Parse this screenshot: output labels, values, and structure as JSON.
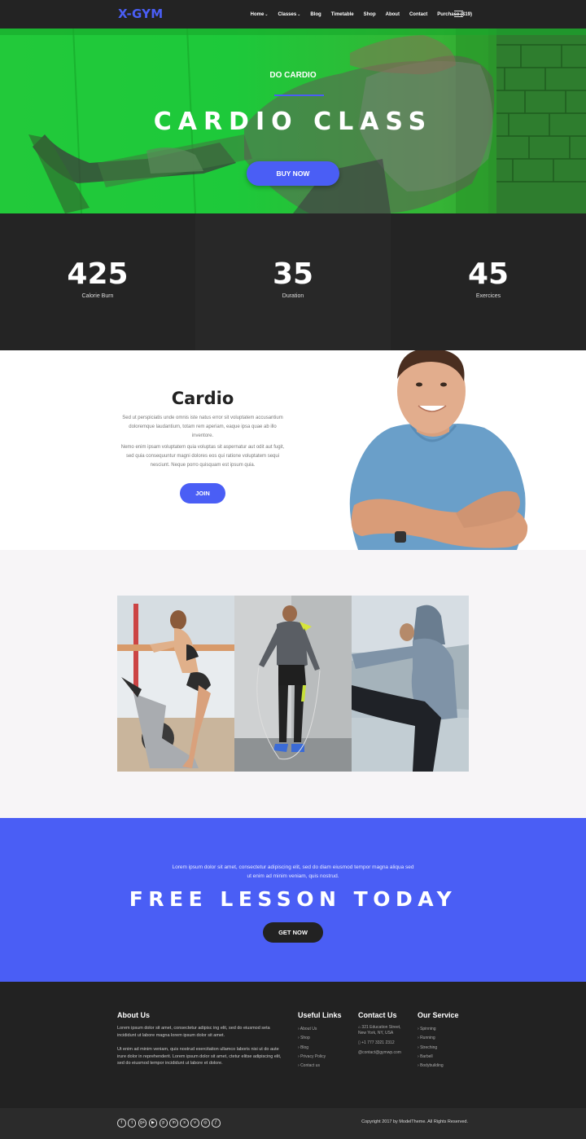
{
  "header": {
    "logo": "X-GYM",
    "nav": [
      {
        "label": "Home",
        "dropdown": true
      },
      {
        "label": "Classes",
        "dropdown": true
      },
      {
        "label": "Blog",
        "dropdown": false
      },
      {
        "label": "Timetable",
        "dropdown": false
      },
      {
        "label": "Shop",
        "dropdown": false
      },
      {
        "label": "About",
        "dropdown": false
      },
      {
        "label": "Contact",
        "dropdown": false
      },
      {
        "label": "Purchase ($19)",
        "dropdown": false
      }
    ],
    "menu_icon": "hamburger-icon"
  },
  "hero": {
    "subtitle": "DO CARDIO",
    "title": "CARDIO CLASS",
    "button": "BUY NOW"
  },
  "stats": [
    {
      "value": "425",
      "label": "Calorie Burn"
    },
    {
      "value": "35",
      "label": "Duration"
    },
    {
      "value": "45",
      "label": "Exercices"
    }
  ],
  "cardio": {
    "title": "Cardio",
    "p1": "Sed ut perspiciatis unde omnis iste natus error sit voluptatem accusantium doloremque laudantium, totam rem aperiam, eaque ipsa quae ab illo inventore.",
    "p2": "Nemo enim ipsam voluptatem quia voluptas sit aspernatur aut odit aut fugit, sed quia consequuntur magni dolores eos qui ratione voluptatem sequi nesciunt. Neque porro quisquam est ipsum quia.",
    "button": "JOIN"
  },
  "cta": {
    "text": "Lorem ipsum dolor sit amet, consectetur adipiscing elit, sed do diam eiusmod tempor magna aliqua sed ut enim ad minim veniam, quis nostrud.",
    "title": "FREE LESSON TODAY",
    "button": "GET NOW"
  },
  "footer": {
    "about": {
      "heading": "About Us",
      "p1": "Lorem ipsum dolor sit amet, consectetur adipisc ing elit, sed do eiusmod seta incididunt ut labore magna lorem ipsum dolor sit amet.",
      "p2": "Ut enim ad minim veniam, quis nostrud exercitation ullamco laboris nisi ut do aute irure dolor in reprehenderit. Lorem ipsum dolor sit amet, ctetur elitse adipiscing elit, sed do eiusmod tempor incididunt ut labore et dolore."
    },
    "links": {
      "heading": "Useful Links",
      "items": [
        "About Us",
        "Shop",
        "Blog",
        "Privacy Policy",
        "Contact us"
      ]
    },
    "contact": {
      "heading": "Contact Us",
      "address1": "321 Education Street,",
      "address2": "New York, NY, USA",
      "phone": "+1 777 3321 2312",
      "email": "contact@gymwp.com"
    },
    "service": {
      "heading": "Our Service",
      "items": [
        "Spinning",
        "Running",
        "Streching",
        "Barbell",
        "Bodybuilding"
      ]
    },
    "socials": [
      "facebook-icon",
      "twitter-icon",
      "google-plus-icon",
      "youtube-icon",
      "pinterest-icon",
      "linkedin-icon",
      "skype-icon",
      "vimeo-icon",
      "dribbble-icon",
      "foursquare-icon"
    ],
    "copyright": "Copyright 2017 by ModelTheme. All Rights Reserved."
  },
  "colors": {
    "accent": "#4a5ef5",
    "dark": "#222222",
    "hero_green": "#22c93a"
  }
}
